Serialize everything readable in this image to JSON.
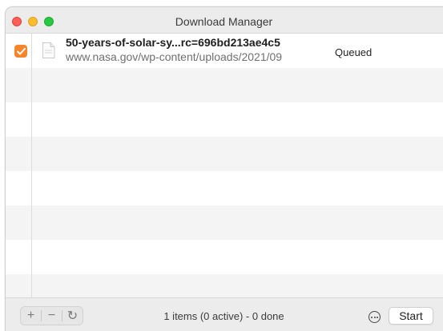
{
  "window": {
    "title": "Download Manager"
  },
  "downloads": [
    {
      "checked": true,
      "name": "50-years-of-solar-sy...rc=696bd213ae4c5",
      "url": "www.nasa.gov/wp-content/uploads/2021/09",
      "status": "Queued"
    }
  ],
  "toolbar": {
    "add_label": "+",
    "remove_label": "−",
    "refresh_label": "↻"
  },
  "footer": {
    "status": "1 items (0 active) - 0 done",
    "start_label": "Start"
  },
  "colors": {
    "checkbox_accent": "#f5842a",
    "stripe": "#f4f4f4"
  },
  "icons": {
    "more": "ellipsis-circle-icon",
    "file": "document-icon",
    "refresh": "refresh-icon"
  }
}
